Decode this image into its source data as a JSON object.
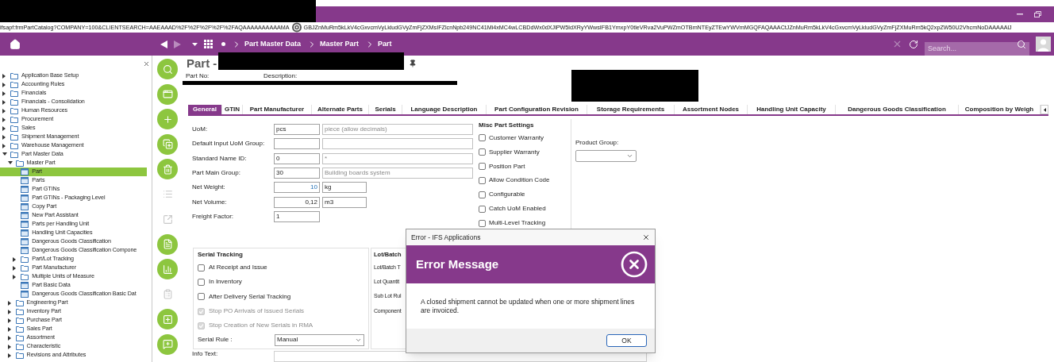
{
  "address_bar": {
    "url_start": "ifsapf:frmPartCatalog?COMPANY=100&CLIENTSEARCH=AAEAAAD%2F%2F%2F%2F%2FAQAAAAAAAAAAMA",
    "url_end": "GBJZnMuRm5kLkV4cGxvcmVyLkludGVyZmFjZXMsIFZlcnNpb249NC41Mi4xMC4wLCBDdWx0dXJlPW5ldXRyYWwsIFB1YmxpY0tleVRva2VuPWZmOTBmNTEyZTEwYWVmMGQFAQAAACtJZnMuRm5kLkV4cGxvcmVyLkludGVyZmFjZXMuRm5kQ2xpZW50U2VhcmNoDAAAAAlJ"
  },
  "nav": {
    "breadcrumbs": [
      "Part Master Data",
      "Master Part",
      "Part"
    ],
    "search": {
      "placeholder": "Search..."
    }
  },
  "sidebar": {
    "items": [
      {
        "label": "Application Base Setup",
        "kind": "folder",
        "expanded": false,
        "selected": false
      },
      {
        "label": "Accounting Rules",
        "kind": "folder",
        "expanded": false,
        "selected": false
      },
      {
        "label": "Financials",
        "kind": "folder",
        "expanded": false,
        "selected": false
      },
      {
        "label": "Financials - Consolidation",
        "kind": "folder",
        "expanded": false,
        "selected": false
      },
      {
        "label": "Human Resources",
        "kind": "folder",
        "expanded": false,
        "selected": false
      },
      {
        "label": "Procurement",
        "kind": "folder",
        "expanded": false,
        "selected": false
      },
      {
        "label": "Sales",
        "kind": "folder",
        "expanded": false,
        "selected": false
      },
      {
        "label": "Shipment Management",
        "kind": "folder",
        "expanded": false,
        "selected": false
      },
      {
        "label": "Warehouse Management",
        "kind": "folder",
        "expanded": false,
        "selected": false
      },
      {
        "label": "Part Master Data",
        "kind": "folder",
        "expanded": true,
        "selected": false,
        "children": [
          {
            "label": "Master Part",
            "kind": "folder",
            "expanded": true,
            "selected": false,
            "children": [
              {
                "label": "Part",
                "kind": "page",
                "selected": true
              },
              {
                "label": "Parts",
                "kind": "page",
                "selected": false
              },
              {
                "label": "Part GTINs",
                "kind": "page",
                "selected": false
              },
              {
                "label": "Part GTINs - Packaging Level",
                "kind": "page",
                "selected": false
              },
              {
                "label": "Copy Part",
                "kind": "page",
                "selected": false
              },
              {
                "label": "New Part Assistant",
                "kind": "page",
                "selected": false
              },
              {
                "label": "Parts per Handling Unit",
                "kind": "page",
                "selected": false
              },
              {
                "label": "Handling Unit Capacities",
                "kind": "page",
                "selected": false
              },
              {
                "label": "Dangerous Goods Classification",
                "kind": "page",
                "selected": false
              },
              {
                "label": "Dangerous Goods Classification Compone",
                "kind": "page",
                "selected": false
              },
              {
                "label": "Part/Lot Tracking",
                "kind": "folder",
                "expanded": false,
                "selected": false
              },
              {
                "label": "Part Manufacturer",
                "kind": "folder",
                "expanded": false,
                "selected": false
              },
              {
                "label": "Multiple Units of Measure",
                "kind": "folder",
                "expanded": false,
                "selected": false
              },
              {
                "label": "Part Basic Data",
                "kind": "page",
                "selected": false
              },
              {
                "label": "Dangerous Goods Classification Basic Dat",
                "kind": "page",
                "selected": false
              }
            ]
          },
          {
            "label": "Engineering Part",
            "kind": "folder",
            "expanded": false,
            "selected": false
          },
          {
            "label": "Inventory Part",
            "kind": "folder",
            "expanded": false,
            "selected": false
          },
          {
            "label": "Purchase Part",
            "kind": "folder",
            "expanded": false,
            "selected": false
          },
          {
            "label": "Sales Part",
            "kind": "folder",
            "expanded": false,
            "selected": false
          },
          {
            "label": "Assortment",
            "kind": "folder",
            "expanded": false,
            "selected": false
          },
          {
            "label": "Characteristic",
            "kind": "folder",
            "expanded": false,
            "selected": false
          },
          {
            "label": "Revisions and Attributes",
            "kind": "folder",
            "expanded": false,
            "selected": false
          }
        ]
      }
    ]
  },
  "toolbar": [
    {
      "disabled": false
    },
    {
      "disabled": false
    },
    {
      "disabled": false
    },
    {
      "disabled": false
    },
    {
      "disabled": false
    },
    {
      "disabled": true
    },
    {
      "disabled": true
    },
    {
      "disabled": false
    },
    {
      "disabled": false
    },
    {
      "disabled": true
    },
    {
      "disabled": false
    },
    {
      "disabled": false
    }
  ],
  "page": {
    "title": "Part -",
    "part_no_label": "Part No:",
    "description_label": "Description:"
  },
  "tabs": [
    {
      "label": "General",
      "selected": true
    },
    {
      "label": "GTIN",
      "selected": false
    },
    {
      "label": "Part Manufacturer",
      "selected": false
    },
    {
      "label": "Alternate Parts",
      "selected": false
    },
    {
      "label": "Serials",
      "selected": false
    },
    {
      "label": "Language Description",
      "selected": false
    },
    {
      "label": "Part Configuration Revision",
      "selected": false
    },
    {
      "label": "Storage Requirements",
      "selected": false
    },
    {
      "label": "Assortment Nodes",
      "selected": false
    },
    {
      "label": "Handling Unit Capacity",
      "selected": false
    },
    {
      "label": "Dangerous Goods Classification",
      "selected": false
    },
    {
      "label": "Composition by Weigh",
      "selected": false
    }
  ],
  "general": {
    "fields": [
      {
        "label": "UoM:",
        "kind": "with_description",
        "value": "pcs",
        "description": "piece (allow decimals)"
      },
      {
        "label": "Default Input UoM Group:",
        "kind": "with_description"
      },
      {
        "label": "Standard Name ID:",
        "kind": "with_description",
        "value": "0",
        "description": "*"
      },
      {
        "label": "Part Main Group:",
        "kind": "with_description",
        "value": "30",
        "description": "Building boards system"
      },
      {
        "label": "Net Weight:",
        "kind": "with_unit",
        "value": "10",
        "numeric": true,
        "highlighted": true,
        "description": "kg"
      },
      {
        "label": "Net Volume:",
        "kind": "with_unit",
        "value": "0,12",
        "numeric": true,
        "highlighted": false,
        "description": "m3"
      },
      {
        "label": "Freight Factor:",
        "kind": "single",
        "value": "1"
      }
    ]
  },
  "misc_settings": {
    "title": "Misc Part Settings",
    "options": [
      {
        "label": "Customer Warranty",
        "checked": false
      },
      {
        "label": "Supplier Warranty",
        "checked": false
      },
      {
        "label": "Position Part",
        "checked": false
      },
      {
        "label": "Allow Condition Code",
        "checked": false
      },
      {
        "label": "Configurable",
        "checked": false
      },
      {
        "label": "Catch UoM Enabled",
        "checked": false
      },
      {
        "label": "Multi-Level Tracking",
        "checked": false
      }
    ]
  },
  "product_group": {
    "label": "Product Group:"
  },
  "serial_tracking": {
    "title": "Serial Tracking",
    "options": [
      {
        "label": "At Receipt and Issue",
        "checked": false,
        "disabled": false
      },
      {
        "label": "In Inventory",
        "checked": false,
        "disabled": false
      },
      {
        "label": "After Delivery Serial Tracking",
        "checked": false,
        "disabled": false
      },
      {
        "label": "Stop PO Arrivals of Issued Serials",
        "checked": true,
        "disabled": true
      },
      {
        "label": "Stop Creation of New Serials in RMA",
        "checked": true,
        "disabled": true
      }
    ],
    "serial_rule": {
      "label": "Serial Rule :",
      "value": "Manual"
    }
  },
  "lot_batch": {
    "title": "Lot/Batch",
    "labels": [
      "Lot/Batch T",
      "Lot Quantit",
      "Sub Lot Rul",
      "Component"
    ]
  },
  "info_text": {
    "label": "Info Text:"
  },
  "dialog": {
    "title": "Error - IFS Applications",
    "heading": "Error Message",
    "message": "A closed shipment cannot be updated when one or more shipment lines are invoiced.",
    "buttons": [
      "OK"
    ]
  }
}
